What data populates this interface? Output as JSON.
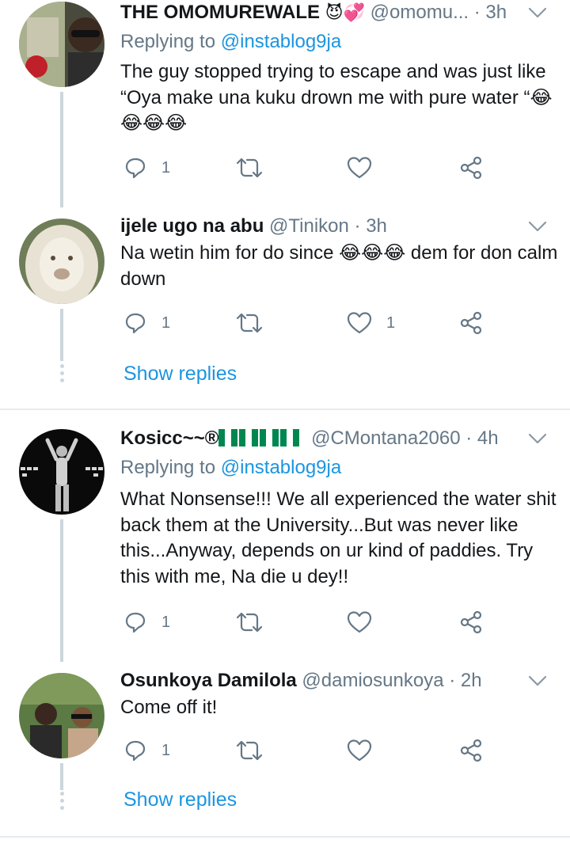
{
  "tweets": [
    {
      "name": "THE OMOMUREWALE",
      "handle": "@omomu...",
      "time": "· 3h",
      "replying_label": "Replying to",
      "replying_to": "@instablog9ja",
      "text": "The guy stopped trying to escape and was just like “Oya make una kuku drown me with pure water “",
      "text_emoji": "😂😂😂😂",
      "reply_count": "1",
      "like_count": "",
      "name_emojis": "😈💞"
    },
    {
      "name": "ijele ugo na abu",
      "handle": "@Tinikon",
      "time": "· 3h",
      "text_before": "Na wetin him for do since ",
      "text_emoji": "😂😂😂",
      "text_after": " dem for don calm down",
      "reply_count": "1",
      "like_count": "1"
    },
    {
      "name": "Kosicc~~®",
      "handle": "@CMontana2060",
      "time": "· 4h",
      "replying_label": "Replying to",
      "replying_to": "@instablog9ja",
      "text": "What Nonsense!!! We all experienced the water shit back them at the University...But was never like this...Anyway, depends on ur kind of paddies. Try this with me, Na die u dey!!",
      "reply_count": "1",
      "like_count": ""
    },
    {
      "name": "Osunkoya Damilola",
      "handle": "@damiosunkoya",
      "time": "· 2h",
      "text": "Come off it!",
      "reply_count": "1",
      "like_count": ""
    }
  ],
  "show_replies_label": "Show replies",
  "colors": {
    "link": "#1b95e0",
    "muted": "#657786",
    "thread_line": "#ccd6dd",
    "separator": "#e6ecf0",
    "nigeria_green": "#008751"
  },
  "icons": [
    "reply-icon",
    "retweet-icon",
    "like-icon",
    "share-icon",
    "chevron-down-icon"
  ]
}
